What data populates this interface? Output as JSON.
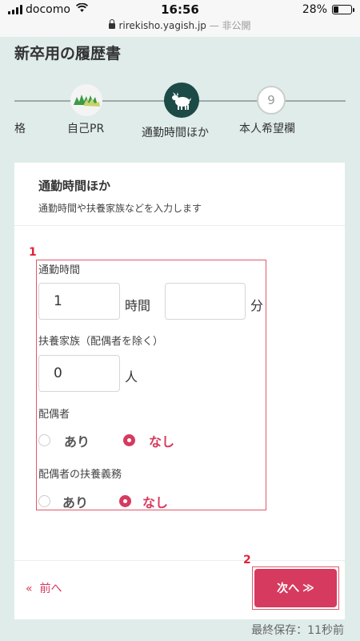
{
  "status_bar": {
    "carrier": "docomo",
    "time": "16:56",
    "battery": "28%",
    "battery_level": 0.28,
    "url": "rirekisho.yagish.jp",
    "privacy": "— 非公開"
  },
  "page": {
    "title": "新卒用の履歴書"
  },
  "steps": {
    "left_partial": "格",
    "prev_label": "自己PR",
    "current_label": "通勤時間ほか",
    "next_label": "本人希望欄",
    "next_number": "9"
  },
  "card": {
    "title": "通勤時間ほか",
    "subtitle": "通勤時間や扶養家族などを入力します"
  },
  "commute": {
    "label": "通勤時間",
    "hours_value": "1",
    "hours_unit": "時間",
    "minutes_value": "",
    "minutes_unit": "分"
  },
  "dependents": {
    "label": "扶養家族（配偶者を除く）",
    "value": "0",
    "unit": "人"
  },
  "spouse": {
    "label": "配偶者",
    "option_yes": "あり",
    "option_no": "なし",
    "selected": "なし"
  },
  "spouse_support": {
    "label": "配偶者の扶養義務",
    "option_yes": "あり",
    "option_no": "なし",
    "selected": "なし"
  },
  "annotations": {
    "box1": "1",
    "box2": "2"
  },
  "nav": {
    "back_icon": "«",
    "back_label": "前へ",
    "next_label": "次へ",
    "next_icon": "≫"
  },
  "save_status": "最終保存：11秒前",
  "colors": {
    "accent": "#d63a5f",
    "step_active": "#1c4a47",
    "background": "#dfecea"
  }
}
